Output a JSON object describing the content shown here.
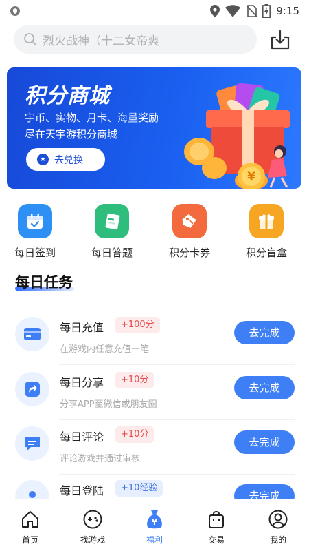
{
  "status_bar": {
    "time": "9:15"
  },
  "search": {
    "placeholder": "烈火战神（十二女帝爽"
  },
  "banner": {
    "title": "积分商城",
    "line1": "宇币、实物、月卡、海量奖励",
    "line2": "尽在天宇游积分商城",
    "button_label": "去兑换",
    "coin_symbol": "¥"
  },
  "quick_entries": [
    {
      "label": "每日签到",
      "icon": "calendar-check-icon",
      "color": "#2e8ff5"
    },
    {
      "label": "每日答题",
      "icon": "quiz-card-icon",
      "color": "#2ebd7d"
    },
    {
      "label": "积分卡券",
      "icon": "coupon-icon",
      "color": "#f26a3d"
    },
    {
      "label": "积分盲盒",
      "icon": "gift-box-icon",
      "color": "#f6a623"
    }
  ],
  "tasks_section": {
    "title": "每日任务"
  },
  "tasks": [
    {
      "title": "每日充值",
      "badge": "+100分",
      "desc": "在游戏内任意充值一笔",
      "button": "去完成",
      "icon": "card-icon"
    },
    {
      "title": "每日分享",
      "badge": "+10分",
      "desc": "分享APP至微信或朋友圈",
      "button": "去完成",
      "icon": "share-icon"
    },
    {
      "title": "每日评论",
      "badge": "+10分",
      "desc": "评论游戏并通过审核",
      "button": "去完成",
      "icon": "comment-icon"
    },
    {
      "title": "每日登陆",
      "badge": "+10经验",
      "desc": "",
      "button": "去完成",
      "icon": "user-icon"
    }
  ],
  "bottom_nav": [
    {
      "label": "首页",
      "icon": "home-icon",
      "active": false
    },
    {
      "label": "找游戏",
      "icon": "gamepad-icon",
      "active": false
    },
    {
      "label": "福利",
      "icon": "money-bag-icon",
      "active": true
    },
    {
      "label": "交易",
      "icon": "shopping-bag-icon",
      "active": false
    },
    {
      "label": "我的",
      "icon": "profile-icon",
      "active": false
    }
  ],
  "colors": {
    "accent": "#3f7ff5",
    "banner": "#1a5ff0",
    "badge_red": "#e84a4a"
  }
}
